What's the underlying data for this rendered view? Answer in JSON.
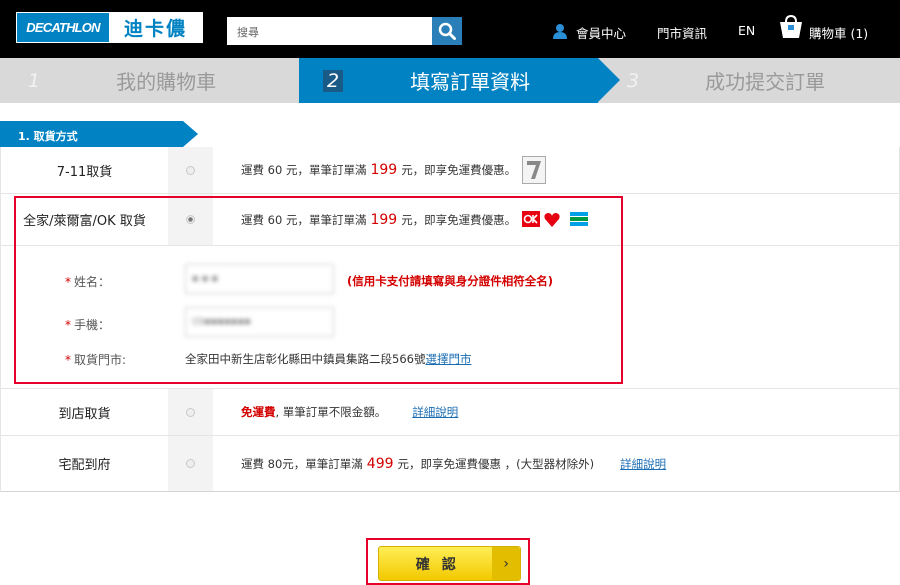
{
  "header": {
    "logo_en": "DECATHLON",
    "logo_zh": "迪卡儂",
    "search_placeholder": "搜尋",
    "member_center": "會員中心",
    "store_info": "門市資訊",
    "lang": "EN",
    "cart": "購物車 (1)"
  },
  "steps": [
    {
      "num": "1",
      "label": "我的購物車"
    },
    {
      "num": "2",
      "label": "填寫訂單資料"
    },
    {
      "num": "3",
      "label": "成功提交訂單"
    }
  ],
  "section": {
    "title": "1. 取貨方式"
  },
  "options": {
    "seven": {
      "label": "7-11取貨",
      "desc_prefix": "運費 60 元，單筆訂單滿",
      "threshold": "199",
      "desc_suffix": "元，即享免運費優惠。"
    },
    "family": {
      "label": "全家/萊爾富/OK 取貨",
      "desc_prefix": "運費 60 元，單筆訂單滿",
      "threshold": "199",
      "desc_suffix": "元，即享免運費優惠。"
    },
    "store": {
      "label": "到店取貨",
      "free": "免運費",
      "desc": ", 單筆訂單不限金額。",
      "detail": "詳細說明"
    },
    "home": {
      "label": "宅配到府",
      "desc_prefix": "運費 80元，單筆訂單滿",
      "threshold": "499",
      "desc_suffix": "元，即享免運費優惠 ，(大型器材除外)",
      "detail": "詳細說明"
    }
  },
  "form": {
    "name_label": "姓名：",
    "name_value": "■ ■ ■",
    "name_hint": "(信用卡支付請填寫與身分證件相符全名)",
    "phone_label": "手機：",
    "phone_value": "09■■■■■■■",
    "store_label": "取貨門市:",
    "store_value": "全家田中新生店彰化縣田中鎮員集路二段566號",
    "select_store": "選擇門市"
  },
  "confirm": {
    "label": "確認",
    "arrow": "›"
  },
  "colors": {
    "brand_blue": "#0082c3",
    "highlight_red": "#e4002b",
    "button_yellow": "#f2c900"
  }
}
